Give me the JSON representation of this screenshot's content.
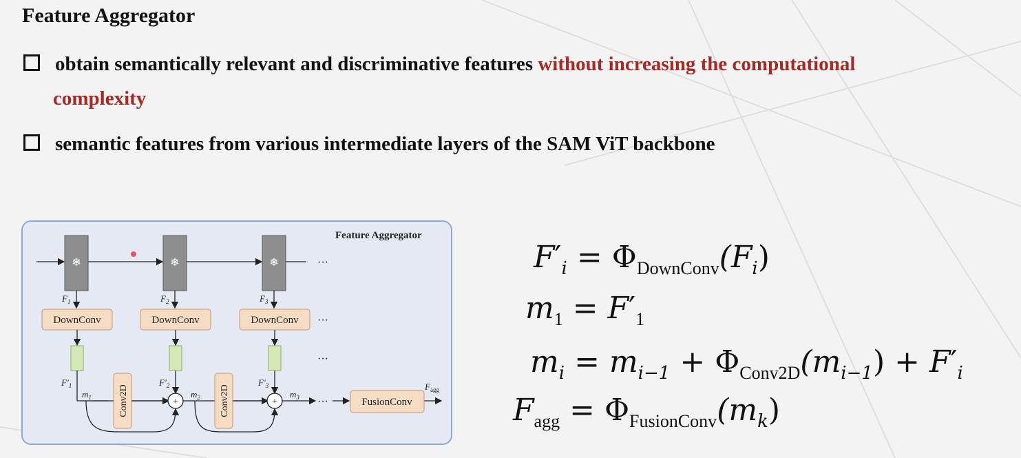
{
  "slide": {
    "title": "Feature Aggregator",
    "bullets": [
      {
        "text": "obtain semantically relevant and discriminative features ",
        "highlight": "without increasing the computational",
        "highlight_cont": "complexity"
      },
      {
        "text": "semantic features from various intermediate layers of the SAM ViT backbone"
      }
    ],
    "highlight_color": "#a52a24"
  },
  "figure": {
    "title": "Feature Aggregator",
    "downconv_label": "DownConv",
    "conv2d_label": "Conv2D",
    "fusion_label": "FusionConv",
    "feature_labels": [
      "F",
      "F",
      "F"
    ],
    "feature_subs": [
      "1",
      "2",
      "3"
    ],
    "fprime_labels": [
      "F",
      "F",
      "F"
    ],
    "m_labels": [
      "m",
      "m",
      "m"
    ],
    "m_subs": [
      "1",
      "2",
      "3"
    ],
    "output_label": "F",
    "output_sub": "agg",
    "ellipsis": "···",
    "frozen_icon": "snowflake-icon",
    "plus": "+"
  },
  "equations": {
    "eq1": {
      "lhs": "F",
      "lhs_sub": "i",
      "lhs_prime": "′",
      "eq": "=",
      "phi": "Φ",
      "phi_sub": "DownConv",
      "arg": "(F",
      "arg_sub": "i",
      "close": ")"
    },
    "eq2": {
      "lhs": "m",
      "lhs_sub": "1",
      "eq": "=",
      "rhs": "F",
      "rhs_sub": "1",
      "rhs_prime": "′"
    },
    "eq3": {
      "lhs": "m",
      "lhs_sub": "i",
      "eq": "=",
      "t1": "m",
      "t1_sub": "i−1",
      "plus": "+",
      "phi": "Φ",
      "phi_sub": "Conv2D",
      "arg": "(m",
      "arg_sub": "i−1",
      "close": ")",
      "plus2": "+",
      "t3": "F",
      "t3_sub": "i",
      "t3_prime": "′"
    },
    "eq4": {
      "lhs": "F",
      "lhs_sub": "agg",
      "eq": "=",
      "phi": "Φ",
      "phi_sub": "FusionConv",
      "arg": "(m",
      "arg_sub": "k",
      "close": ")"
    }
  }
}
